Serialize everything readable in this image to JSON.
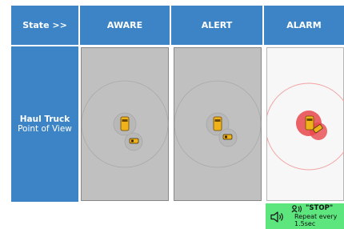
{
  "header": {
    "corner_label": "State >>",
    "states": [
      "AWARE",
      "ALERT",
      "ALARM"
    ]
  },
  "row": {
    "title": "Haul Truck",
    "subtitle": "Point of View"
  },
  "alarm_note": {
    "message": "\"STOP\"",
    "repeat_line1": "Repeat every",
    "repeat_line2": "1.5sec"
  },
  "colors": {
    "header_bg": "#3c84c6",
    "panel_gray": "#c0c0c0",
    "alarm_red": "#e8474c",
    "truck_yellow": "#f0b21a",
    "note_green": "#5de57e"
  },
  "icons": [
    "haul-truck-icon",
    "light-vehicle-icon",
    "speaker-icon",
    "voice-alert-icon"
  ]
}
